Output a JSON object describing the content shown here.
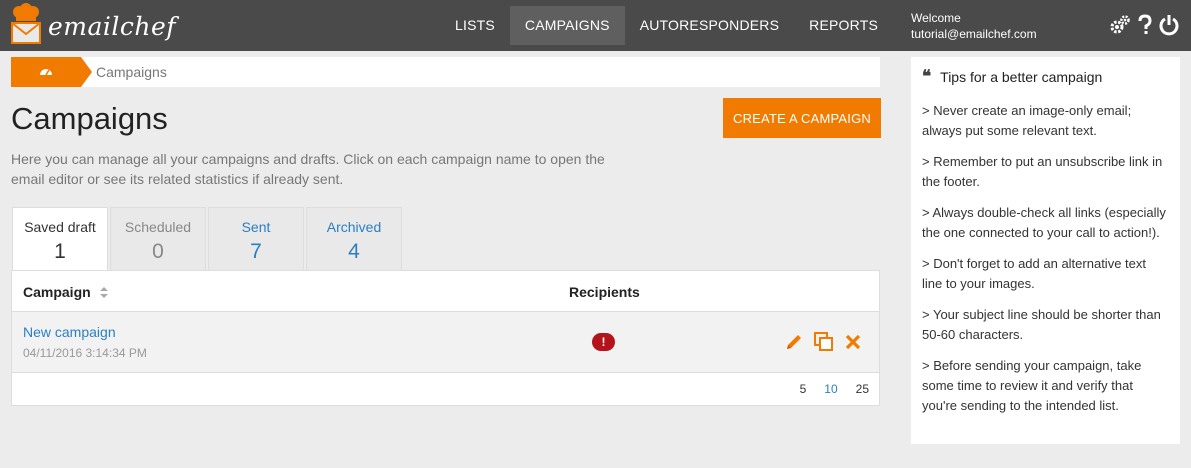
{
  "header": {
    "brand": "emailchef",
    "nav": [
      {
        "label": "LISTS",
        "active": false
      },
      {
        "label": "CAMPAIGNS",
        "active": true
      },
      {
        "label": "AUTORESPONDERS",
        "active": false
      },
      {
        "label": "REPORTS",
        "active": false
      }
    ],
    "welcome_label": "Welcome",
    "user_email": "tutorial@emailchef.com",
    "icons": [
      "gears-icon",
      "help-icon",
      "power-icon"
    ]
  },
  "breadcrumb": {
    "current": "Campaigns",
    "home_icon": "dashboard-icon"
  },
  "main": {
    "title": "Campaigns",
    "create_button": "CREATE A CAMPAIGN",
    "intro": "Here you can manage all your campaigns and drafts. Click on each campaign name to open the email editor or see its related statistics if already sent.",
    "tabs": [
      {
        "label": "Saved draft",
        "count": "1",
        "active": true
      },
      {
        "label": "Scheduled",
        "count": "0",
        "active": false
      },
      {
        "label": "Sent",
        "count": "7",
        "active": false
      },
      {
        "label": "Archived",
        "count": "4",
        "active": false
      }
    ],
    "table": {
      "columns": [
        "Campaign",
        "Recipients"
      ],
      "rows": [
        {
          "name": "New campaign",
          "date": "04/11/2016 3:14:34 PM",
          "recipients_badge": "!"
        }
      ],
      "page_sizes": [
        "5",
        "10",
        "25"
      ]
    }
  },
  "tips": {
    "title": "Tips for a better campaign",
    "items": [
      "> Never create an image-only email; always put some relevant text.",
      "> Remember to put an unsubscribe link in the footer.",
      "> Always double-check all links (especially the one connected to your call to action!).",
      "> Don't forget to add an alternative text line to your images.",
      "> Your subject line should be shorter than 50-60 characters.",
      "> Before sending your campaign, take some time to review it and verify that you're sending to the intended list."
    ]
  },
  "colors": {
    "accent": "#f07b00",
    "link": "#2a7fc4",
    "topbar": "#4a4a4a",
    "danger": "#b3141b"
  }
}
